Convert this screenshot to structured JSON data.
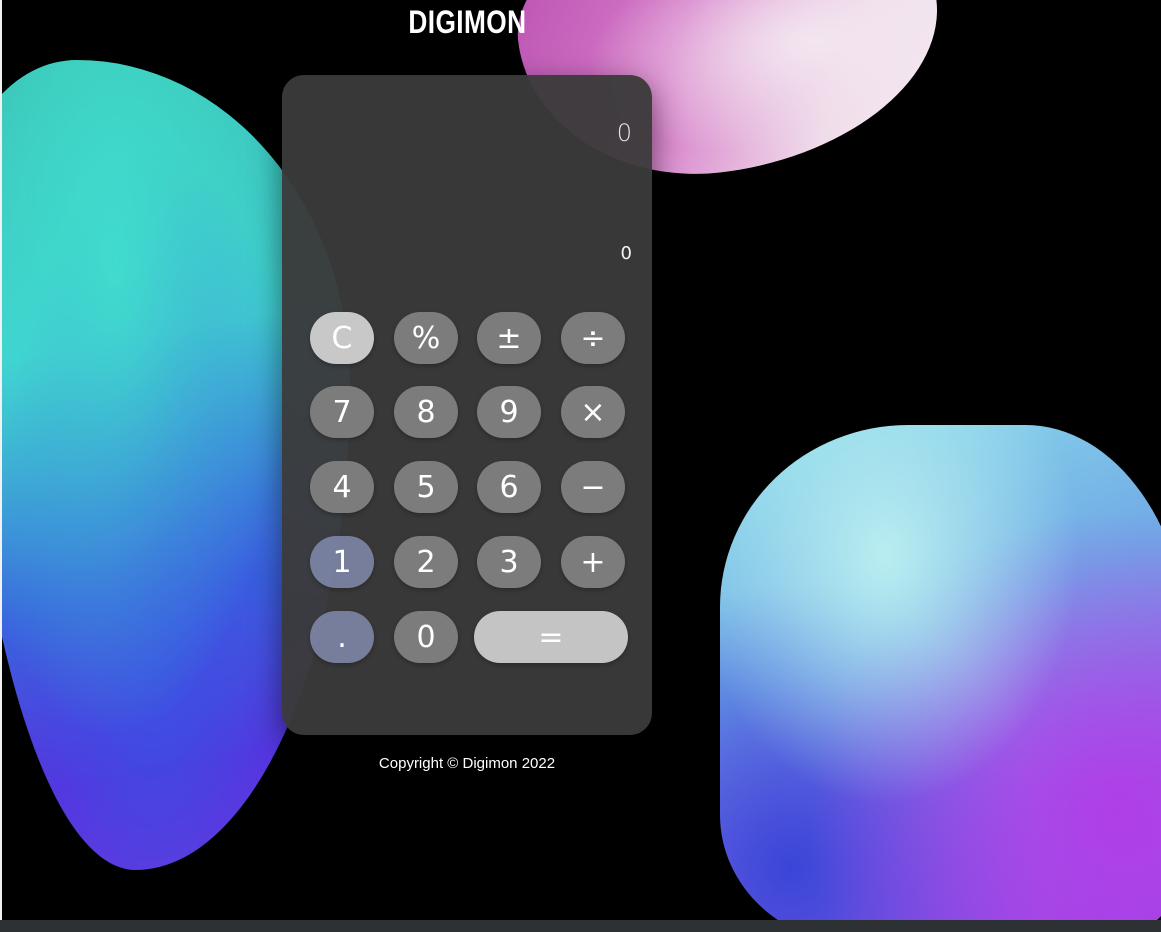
{
  "app": {
    "title": "DIGIMON"
  },
  "display": {
    "main": "0",
    "sub": "0"
  },
  "keys": {
    "clear": "C",
    "percent": "%",
    "sign": "±",
    "divide": "÷",
    "seven": "7",
    "eight": "8",
    "nine": "9",
    "multiply": "×",
    "four": "4",
    "five": "5",
    "six": "6",
    "minus": "−",
    "one": "1",
    "two": "2",
    "three": "3",
    "plus": "+",
    "decimal": ".",
    "zero": "0",
    "equals": "="
  },
  "footer": {
    "copyright": "Copyright © Digimon 2022"
  },
  "colors": {
    "panel": "#3a3a3a",
    "key": "#7c7c7c",
    "key_light": "#c8c8c8"
  }
}
